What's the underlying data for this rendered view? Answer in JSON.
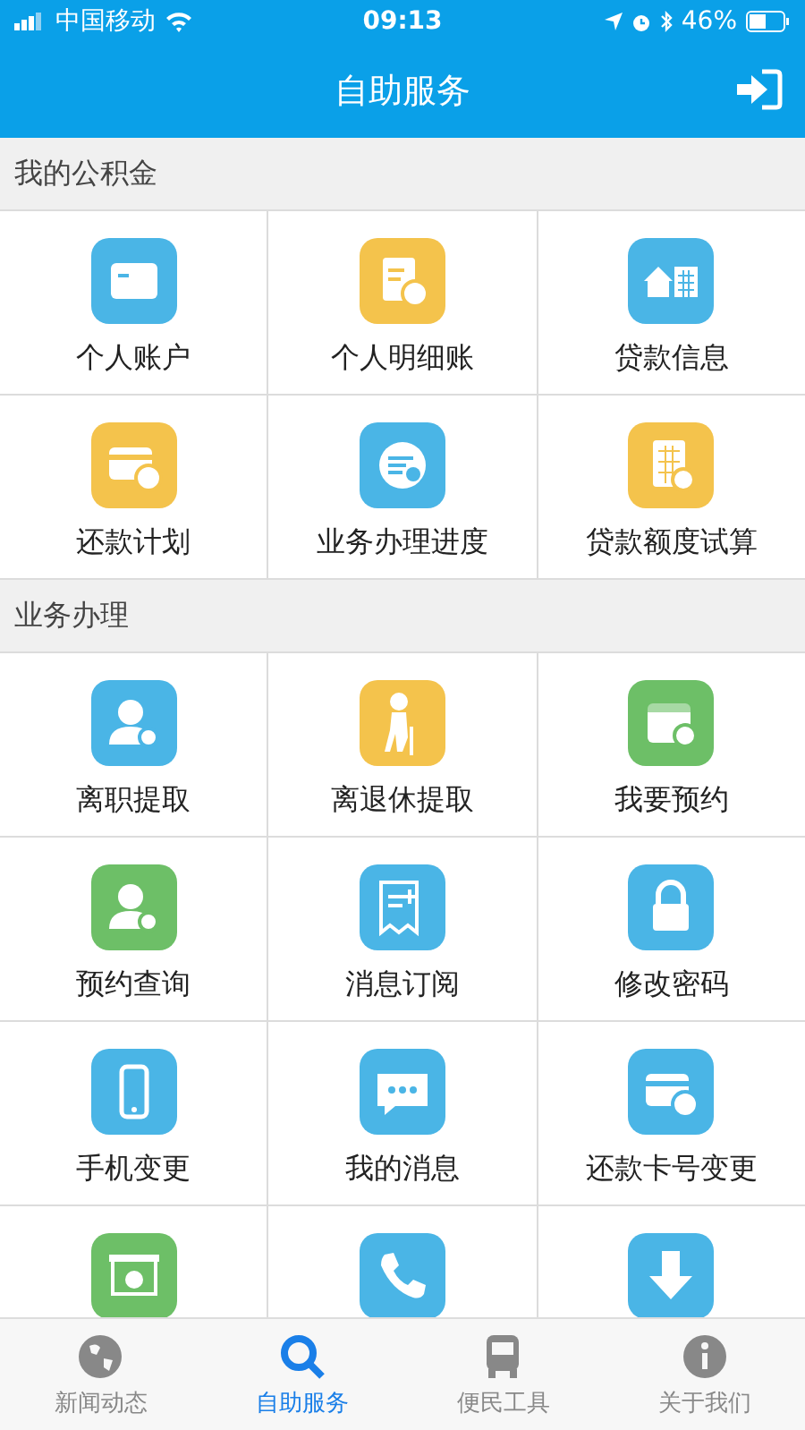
{
  "status_bar": {
    "carrier": "中国移动",
    "time": "09:13",
    "battery": "46%"
  },
  "header": {
    "title": "自助服务"
  },
  "sections": [
    {
      "title": "我的公积金",
      "items": [
        {
          "label": "个人账户",
          "kind": "wallet",
          "color": "#4ab5e6"
        },
        {
          "label": "个人明细账",
          "kind": "ledger",
          "color": "#f4c34c"
        },
        {
          "label": "贷款信息",
          "kind": "house",
          "color": "#4ab5e6"
        },
        {
          "label": "还款计划",
          "kind": "card",
          "color": "#f4c34c"
        },
        {
          "label": "业务办理进度",
          "kind": "progress",
          "color": "#4ab5e6"
        },
        {
          "label": "贷款额度试算",
          "kind": "calculator",
          "color": "#f4c34c"
        }
      ]
    },
    {
      "title": "业务办理",
      "items": [
        {
          "label": "离职提取",
          "kind": "person",
          "color": "#4ab5e6"
        },
        {
          "label": "离退休提取",
          "kind": "elder",
          "color": "#f4c34c"
        },
        {
          "label": "我要预约",
          "kind": "calendar",
          "color": "#6dbf67"
        },
        {
          "label": "预约查询",
          "kind": "person",
          "color": "#6dbf67"
        },
        {
          "label": "消息订阅",
          "kind": "document",
          "color": "#4ab5e6"
        },
        {
          "label": "修改密码",
          "kind": "lock",
          "color": "#4ab5e6"
        },
        {
          "label": "手机变更",
          "kind": "phone",
          "color": "#4ab5e6"
        },
        {
          "label": "我的消息",
          "kind": "chat",
          "color": "#4ab5e6"
        },
        {
          "label": "还款卡号变更",
          "kind": "card",
          "color": "#4ab5e6"
        },
        {
          "kind": "money",
          "color": "#6dbf67"
        },
        {
          "kind": "call",
          "color": "#4ab5e6"
        },
        {
          "kind": "download",
          "color": "#4ab5e6"
        }
      ]
    }
  ],
  "tabs": [
    {
      "label": "新闻动态",
      "kind": "globe",
      "selected": false
    },
    {
      "label": "自助服务",
      "kind": "search",
      "selected": true
    },
    {
      "label": "便民工具",
      "kind": "bus",
      "selected": false
    },
    {
      "label": "关于我们",
      "kind": "info",
      "selected": false
    }
  ]
}
